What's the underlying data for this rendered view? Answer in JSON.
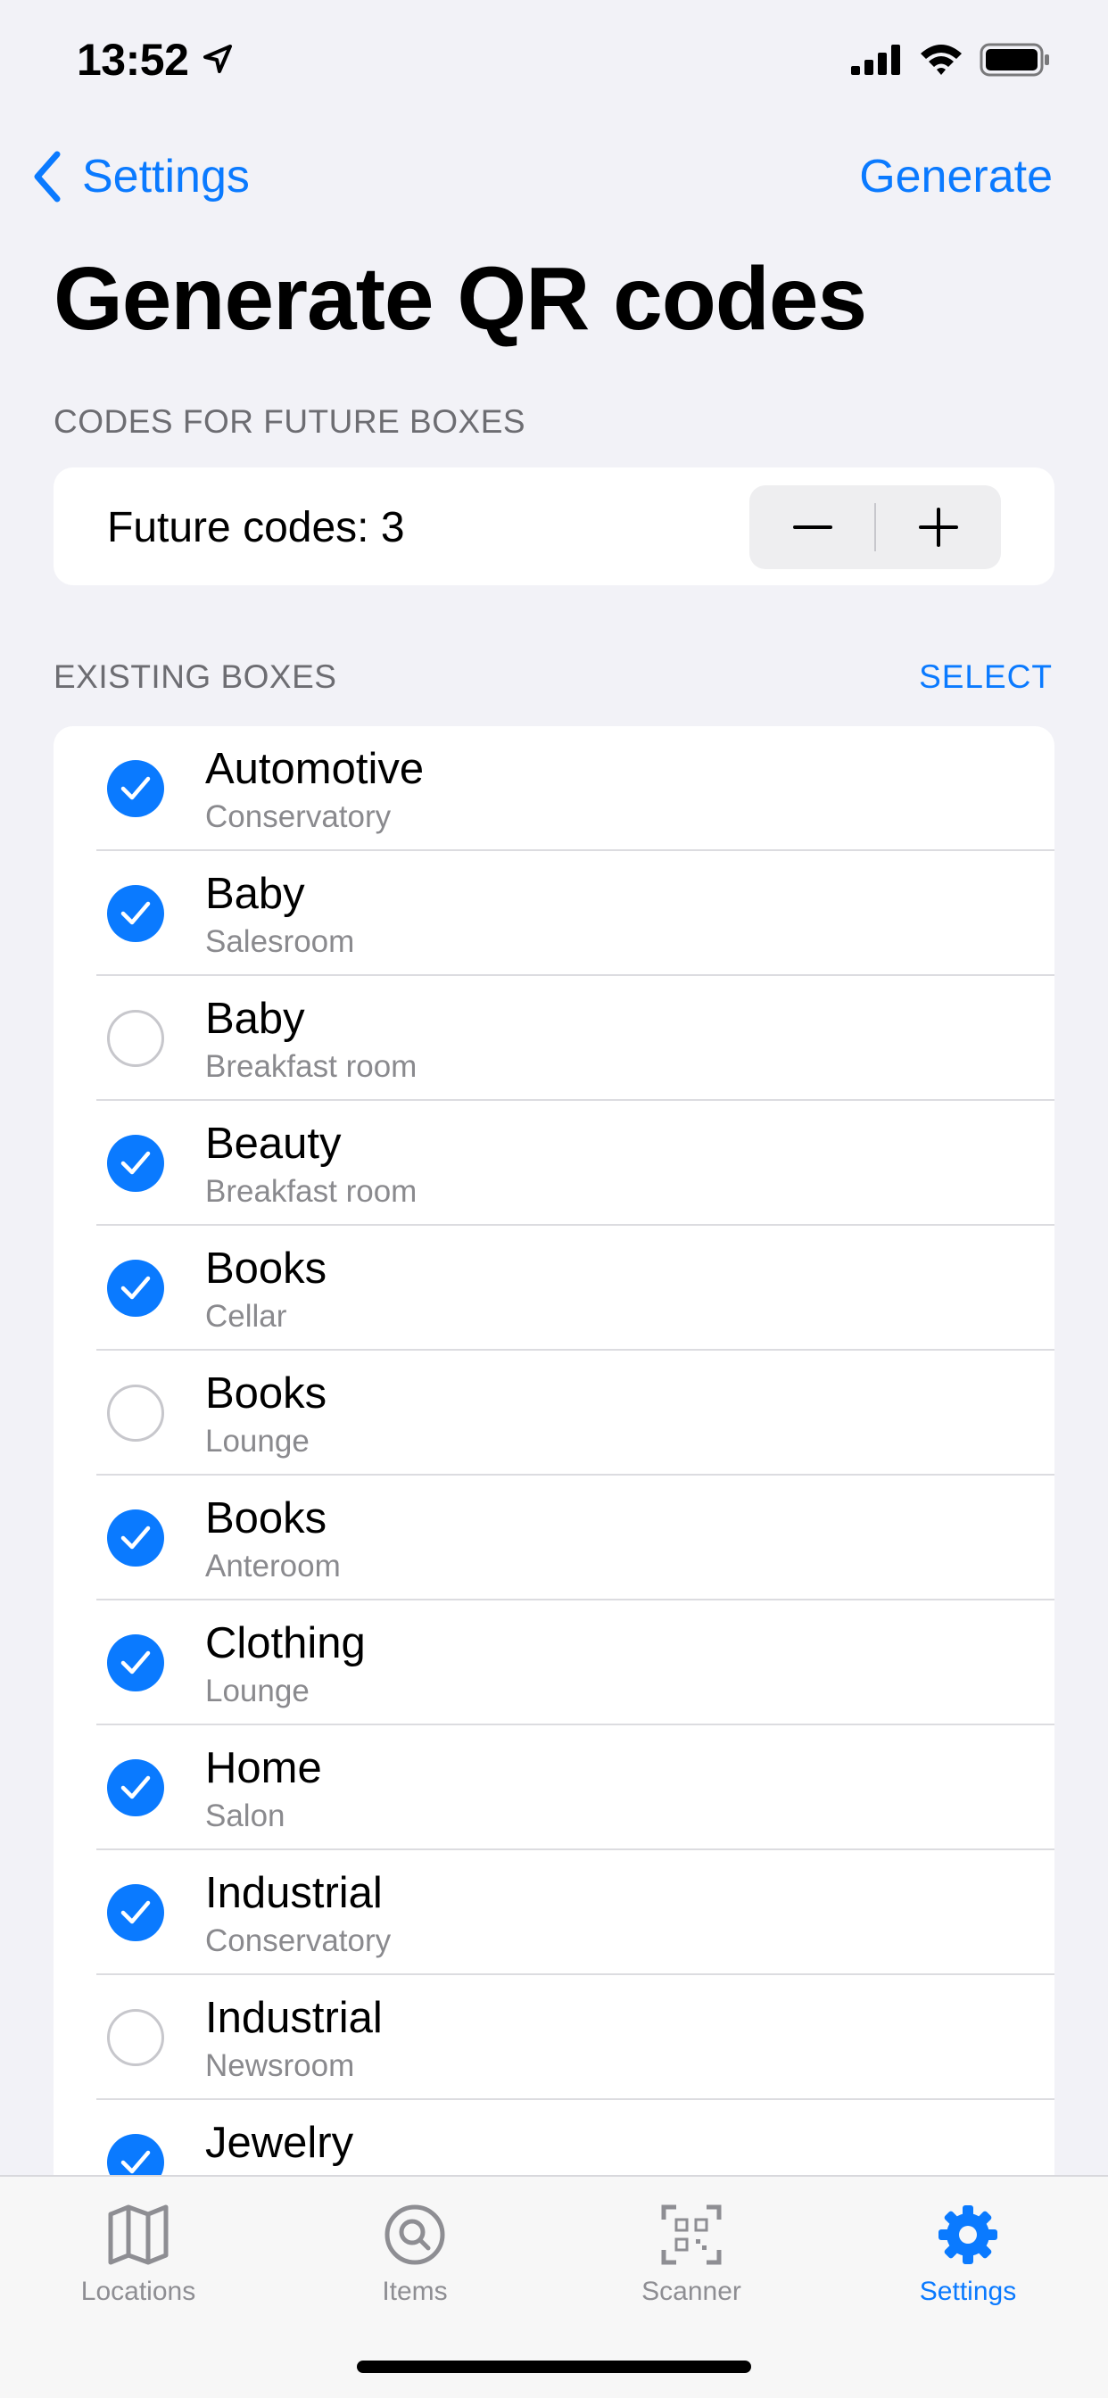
{
  "status": {
    "time": "13:52"
  },
  "nav": {
    "back_label": "Settings",
    "action_label": "Generate"
  },
  "title": "Generate QR codes",
  "future_section": {
    "header": "CODES FOR FUTURE BOXES",
    "label": "Future codes: 3",
    "count": 3
  },
  "existing_section": {
    "header": "EXISTING BOXES",
    "select_label": "SELECT",
    "boxes": [
      {
        "title": "Automotive",
        "subtitle": "Conservatory",
        "checked": true
      },
      {
        "title": "Baby",
        "subtitle": "Salesroom",
        "checked": true
      },
      {
        "title": "Baby",
        "subtitle": "Breakfast room",
        "checked": false
      },
      {
        "title": "Beauty",
        "subtitle": "Breakfast room",
        "checked": true
      },
      {
        "title": "Books",
        "subtitle": "Cellar",
        "checked": true
      },
      {
        "title": "Books",
        "subtitle": "Lounge",
        "checked": false
      },
      {
        "title": "Books",
        "subtitle": "Anteroom",
        "checked": true
      },
      {
        "title": "Clothing",
        "subtitle": "Lounge",
        "checked": true
      },
      {
        "title": "Home",
        "subtitle": "Salon",
        "checked": true
      },
      {
        "title": "Industrial",
        "subtitle": "Conservatory",
        "checked": true
      },
      {
        "title": "Industrial",
        "subtitle": "Newsroom",
        "checked": false
      },
      {
        "title": "Jewelry",
        "subtitle": "",
        "checked": true
      }
    ]
  },
  "tabs": [
    {
      "label": "Locations",
      "icon": "map-icon",
      "active": false
    },
    {
      "label": "Items",
      "icon": "search-icon",
      "active": false
    },
    {
      "label": "Scanner",
      "icon": "qr-scanner-icon",
      "active": false
    },
    {
      "label": "Settings",
      "icon": "gear-icon",
      "active": true
    }
  ],
  "colors": {
    "accent": "#0a7aff",
    "background": "#f2f2f7",
    "inactive": "#8e8e93"
  }
}
